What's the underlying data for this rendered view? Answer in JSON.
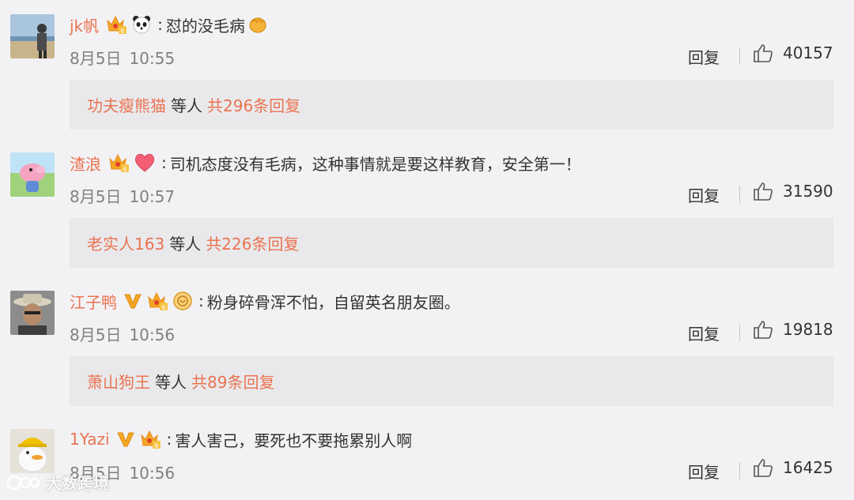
{
  "comments": [
    {
      "user": "jk帆",
      "text": "怼的没毛病",
      "date": "8月5日",
      "time": "10:55",
      "reply_label": "回复",
      "likes": "40157",
      "reply_user": "功夫瘦熊猫",
      "reply_mid": "等人",
      "reply_count": "共296条回复",
      "badges": [
        "vip-crown-badge",
        "panda-badge"
      ],
      "trailing_emoji": "fist-emoji",
      "avatar": "beach-person-avatar"
    },
    {
      "user": "渣浪",
      "text": "司机态度没有毛病，这种事情就是要这样教育，安全第一！",
      "date": "8月5日",
      "time": "10:57",
      "reply_label": "回复",
      "likes": "31590",
      "reply_user": "老实人163",
      "reply_mid": "等人",
      "reply_count": "共226条回复",
      "badges": [
        "vip-crown-badge",
        "heart-badge"
      ],
      "avatar": "peppa-pig-avatar"
    },
    {
      "user": "江子鸭",
      "text": "粉身碎骨浑不怕，自留英名朋友圈。",
      "date": "8月5日",
      "time": "10:56",
      "reply_label": "回复",
      "likes": "19818",
      "reply_user": "萧山狗王",
      "reply_mid": "等人",
      "reply_count": "共89条回复",
      "badges": [
        "verified-v-badge",
        "vip-crown-badge",
        "gold-medal-badge"
      ],
      "avatar": "man-in-hat-avatar"
    },
    {
      "user": "1Yazi",
      "text": "害人害己，要死也不要拖累别人啊",
      "date": "8月5日",
      "time": "10:56",
      "reply_label": "回复",
      "likes": "16425",
      "badges": [
        "verified-v-badge",
        "vip-crown-badge"
      ],
      "avatar": "duck-hardhat-avatar"
    }
  ],
  "watermark": {
    "text": "大数跨境"
  },
  "colors": {
    "username": "#eb7350",
    "meta": "#808080",
    "background": "#f2f2f5",
    "reply_box": "#e9e9ec"
  }
}
